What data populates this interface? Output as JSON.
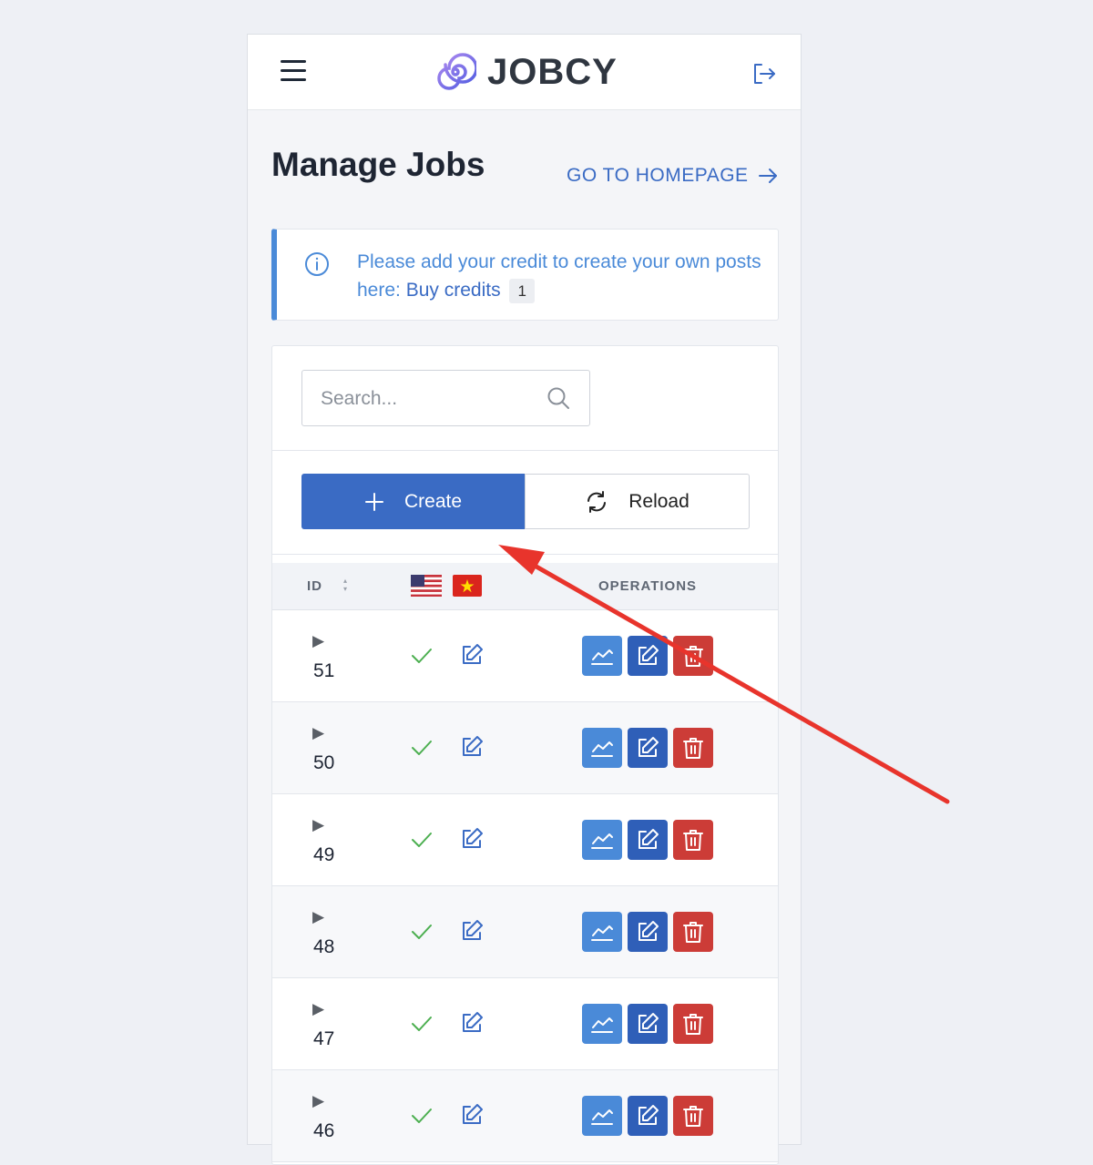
{
  "header": {
    "brand": "JOBCY",
    "menu_icon": "hamburger-icon",
    "logout_icon": "logout-icon"
  },
  "page": {
    "title": "Manage Jobs",
    "homepage_link": "GO TO HOMEPAGE"
  },
  "alert": {
    "text": "Please add your credit to create your own posts here:",
    "link": "Buy credits",
    "badge": "1"
  },
  "toolbar": {
    "search_placeholder": "Search...",
    "create_label": "Create",
    "reload_label": "Reload"
  },
  "table": {
    "columns": {
      "id": "ID",
      "operations": "OPERATIONS"
    },
    "languages": [
      "us-flag-icon",
      "vn-flag-icon"
    ],
    "rows": [
      {
        "id": "51"
      },
      {
        "id": "50"
      },
      {
        "id": "49"
      },
      {
        "id": "48"
      },
      {
        "id": "47"
      },
      {
        "id": "46"
      }
    ]
  },
  "colors": {
    "primary": "#3a6bc4",
    "info": "#4a8ad8",
    "danger": "#cc3c37",
    "success": "#4caf50",
    "annotation_arrow": "#e8342c"
  }
}
